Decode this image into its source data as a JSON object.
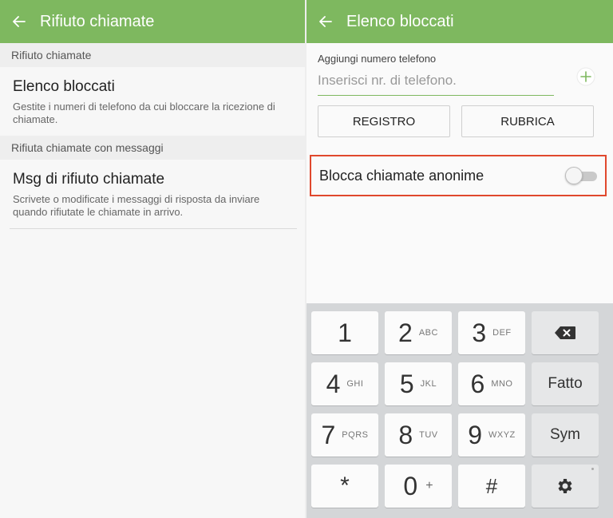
{
  "left": {
    "title": "Rifiuto chiamate",
    "section1": "Rifiuto chiamate",
    "item1": {
      "title": "Elenco bloccati",
      "subtitle": "Gestite i numeri di telefono da cui bloccare la ricezione di chiamate."
    },
    "section2": "Rifiuta chiamate con messaggi",
    "item2": {
      "title": "Msg di rifiuto chiamate",
      "subtitle": "Scrivete o modificate i messaggi di risposta da inviare quando rifiutate le chiamate in arrivo."
    }
  },
  "right": {
    "title": "Elenco bloccati",
    "phone_label": "Aggiungi numero telefono",
    "phone_placeholder": "Inserisci nr. di telefono.",
    "phone_value": "",
    "btn_registro": "REGISTRO",
    "btn_rubrica": "RUBRICA",
    "toggle_label": "Blocca chiamate anonime",
    "toggle_on": false
  },
  "keypad": {
    "rows": [
      [
        {
          "n": "1",
          "s": ""
        },
        {
          "n": "2",
          "s": "ABC"
        },
        {
          "n": "3",
          "s": "DEF"
        }
      ],
      [
        {
          "n": "4",
          "s": "GHI"
        },
        {
          "n": "5",
          "s": "JKL"
        },
        {
          "n": "6",
          "s": "MNO"
        }
      ],
      [
        {
          "n": "7",
          "s": "PQRS"
        },
        {
          "n": "8",
          "s": "TUV"
        },
        {
          "n": "9",
          "s": "WXYZ"
        }
      ]
    ],
    "done": "Fatto",
    "sym": "Sym",
    "star": "*",
    "zero": "0",
    "zero_sub": "+",
    "hash": "#"
  },
  "colors": {
    "appbar": "#7eb85f",
    "highlight": "#e0482d"
  },
  "icons": {
    "back": "arrow-left-icon",
    "add": "plus-icon",
    "backspace": "backspace-icon",
    "settings": "gear-icon"
  }
}
